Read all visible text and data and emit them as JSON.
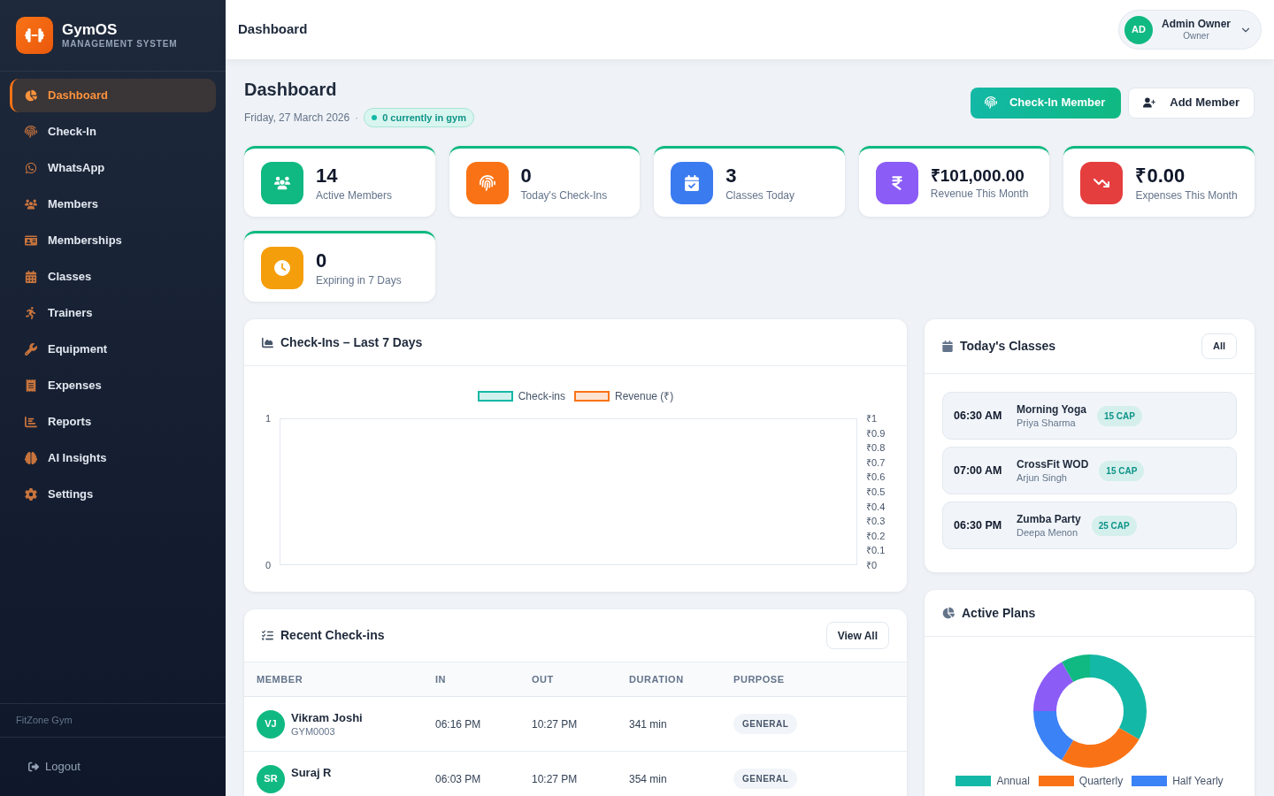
{
  "sidebar": {
    "brand": {
      "name": "GymOS",
      "tagline": "MANAGEMENT SYSTEM"
    },
    "items": [
      {
        "label": "Dashboard",
        "selected": true
      },
      {
        "label": "Check-In",
        "selected": false
      },
      {
        "label": "WhatsApp",
        "selected": false
      },
      {
        "label": "Members",
        "selected": false
      },
      {
        "label": "Memberships",
        "selected": false
      },
      {
        "label": "Classes",
        "selected": false
      },
      {
        "label": "Trainers",
        "selected": false
      },
      {
        "label": "Equipment",
        "selected": false
      },
      {
        "label": "Expenses",
        "selected": false
      },
      {
        "label": "Reports",
        "selected": false
      },
      {
        "label": "AI Insights",
        "selected": false
      },
      {
        "label": "Settings",
        "selected": false
      }
    ],
    "gym_name": "FitZone Gym",
    "logout": "Logout"
  },
  "topbar": {
    "title": "Dashboard",
    "user": {
      "initials": "AD",
      "name": "Admin Owner",
      "role": "Owner"
    }
  },
  "page": {
    "title": "Dashboard",
    "date": "Friday, 27 March 2026",
    "separator": "·",
    "status_badge": "0 currently in gym",
    "actions": [
      {
        "label": "Check-In Member",
        "kind": "primary"
      },
      {
        "label": "Add Member",
        "kind": "secondary"
      }
    ]
  },
  "stats": [
    {
      "value": "14",
      "label": "Active Members",
      "color": "#10b981"
    },
    {
      "value": "0",
      "label": "Today's Check-Ins",
      "color": "#f97316"
    },
    {
      "value": "3",
      "label": "Classes Today",
      "color": "#3b7bf0"
    },
    {
      "value": "₹101,000.00",
      "label": "Revenue This Month",
      "color": "#8b5cf6"
    },
    {
      "value": "₹0.00",
      "label": "Expenses This Month",
      "color": "#e53e3e"
    },
    {
      "value": "0",
      "label": "Expiring in 7 Days",
      "color": "#f59e0b"
    }
  ],
  "checkins_chart": {
    "title": "Check-Ins – Last 7 Days",
    "legend": [
      {
        "label": "Check-ins",
        "color": "#14b8a6"
      },
      {
        "label": "Revenue (₹)",
        "color": "#f97316"
      }
    ],
    "left_axis_labels": [
      "1",
      "0"
    ],
    "right_axis_labels": [
      "₹1",
      "₹0.9",
      "₹0.8",
      "₹0.7",
      "₹0.6",
      "₹0.5",
      "₹0.4",
      "₹0.3",
      "₹0.2",
      "₹0.1",
      "₹0"
    ]
  },
  "recent_checkins": {
    "title": "Recent Check-ins",
    "button": "View All",
    "columns": [
      "MEMBER",
      "IN",
      "OUT",
      "DURATION",
      "PURPOSE"
    ],
    "rows": [
      {
        "initials": "VJ",
        "name": "Vikram Joshi",
        "member_id": "GYM0003",
        "in": "06:16 PM",
        "out": "10:27 PM",
        "duration": "341 min",
        "purpose": "GENERAL"
      },
      {
        "initials": "SR",
        "name": "Suraj R",
        "in": "06:03 PM",
        "out": "10:27 PM",
        "duration": "354 min",
        "purpose": "GENERAL"
      }
    ]
  },
  "todays_classes": {
    "title": "Today's Classes",
    "button": "All",
    "classes": [
      {
        "time": "06:30 AM",
        "name": "Morning Yoga",
        "trainer": "Priya Sharma",
        "capacity": "15 CAP"
      },
      {
        "time": "07:00 AM",
        "name": "CrossFit WOD",
        "trainer": "Arjun Singh",
        "capacity": "15 CAP"
      },
      {
        "time": "06:30 PM",
        "name": "Zumba Party",
        "trainer": "Deepa Menon",
        "capacity": "25 CAP"
      }
    ]
  },
  "active_plans": {
    "title": "Active Plans",
    "chart_data": {
      "type": "donut",
      "categories": [
        "Annual",
        "Quarterly",
        "Half Yearly",
        null,
        null
      ],
      "values": [
        33.3,
        25,
        16.7,
        16.7,
        8.3
      ],
      "colors": [
        "#14b8a6",
        "#f97316",
        "#3b82f6",
        "#8b5cf6",
        "#10b981"
      ],
      "legend": "bottom"
    }
  }
}
